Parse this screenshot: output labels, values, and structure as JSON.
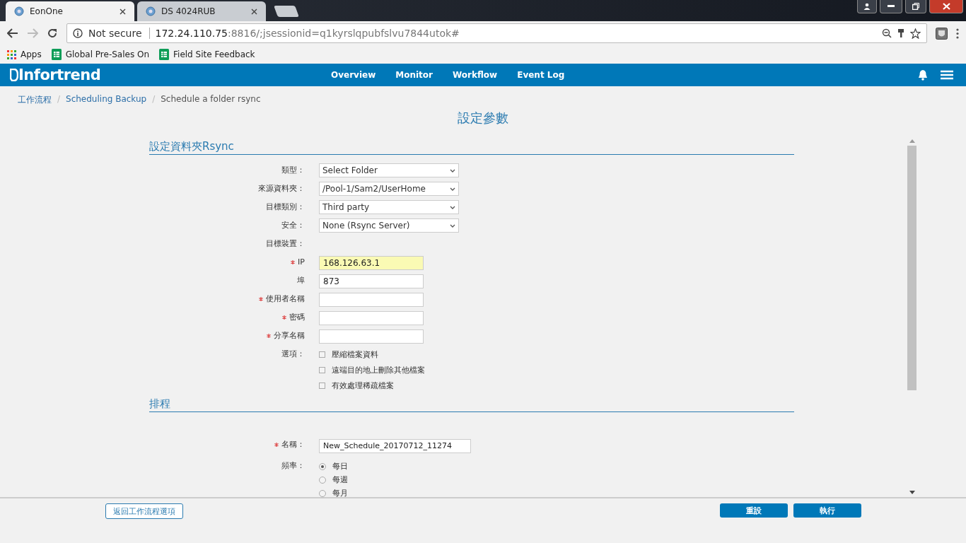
{
  "browser": {
    "tabs": [
      {
        "title": "EonOne",
        "selected": true
      },
      {
        "title": "DS 4024RUB",
        "selected": false
      }
    ],
    "address": {
      "security": "Not secure",
      "host": "172.24.110.75",
      "rest": ":8816/;jsessionid=q1kyrslqpubfslvu7844utok#"
    },
    "bookmarks": [
      {
        "kind": "apps",
        "label": "Apps"
      },
      {
        "kind": "sheet",
        "label": "Global Pre-Sales On"
      },
      {
        "kind": "sheet",
        "label": "Field Site Feedback"
      }
    ]
  },
  "app": {
    "logo": "Infortrend",
    "nav": [
      "Overview",
      "Monitor",
      "Workflow",
      "Event Log"
    ]
  },
  "breadcrumb": [
    {
      "label": "工作流程",
      "link": true
    },
    {
      "separator": "/",
      "label": "Scheduling Backup",
      "link": true
    },
    {
      "separator": "/",
      "label": "Schedule a folder rsync",
      "link": false
    }
  ],
  "page_title": "設定參數",
  "sections": [
    {
      "title": "設定資料夾Rsync",
      "fields": [
        {
          "kind": "select",
          "label": "類型：",
          "required": false,
          "value": "Select Folder"
        },
        {
          "kind": "select",
          "label": "來源資料夾：",
          "required": false,
          "value": "/Pool-1/Sam2/UserHome"
        },
        {
          "kind": "select",
          "label": "目標類別：",
          "required": false,
          "value": "Third party"
        },
        {
          "kind": "select",
          "label": "安全：",
          "required": false,
          "value": "None (Rsync Server)"
        },
        {
          "kind": "heading",
          "label": "目標裝置：",
          "required": false
        },
        {
          "kind": "input",
          "label": "IP",
          "required": true,
          "value": "168.126.63.1",
          "highlighted": true
        },
        {
          "kind": "input",
          "label": "埠",
          "required": false,
          "value": "873",
          "highlighted": false
        },
        {
          "kind": "input",
          "label": "使用者名稱",
          "required": true,
          "highlighted": false
        },
        {
          "kind": "input",
          "label": "密碼",
          "required": true,
          "highlighted": false
        },
        {
          "kind": "input",
          "label": "分享名稱",
          "required": true,
          "highlighted": false
        },
        {
          "kind": "checks",
          "label": "選項：",
          "required": false,
          "options": [
            {
              "label": "壓縮檔案資料",
              "checked": false
            },
            {
              "label": "遠端目的地上刪除其他檔案",
              "checked": false
            },
            {
              "label": "有效處理稀疏檔案",
              "checked": false
            }
          ]
        }
      ]
    },
    {
      "title": "排程",
      "fields": [
        {
          "kind": "wide-input",
          "label": "名稱：",
          "required": true,
          "value": "New_Schedule_20170712_11274",
          "highlighted": false
        },
        {
          "kind": "radios",
          "label": "頻率：",
          "required": false,
          "options": [
            {
              "label": "每日",
              "selected": true
            },
            {
              "label": "每週",
              "selected": false
            },
            {
              "label": "每月",
              "selected": false
            }
          ]
        }
      ]
    }
  ],
  "footer": {
    "back": "返回工作流程選項",
    "actions": [
      "重設",
      "執行"
    ]
  }
}
